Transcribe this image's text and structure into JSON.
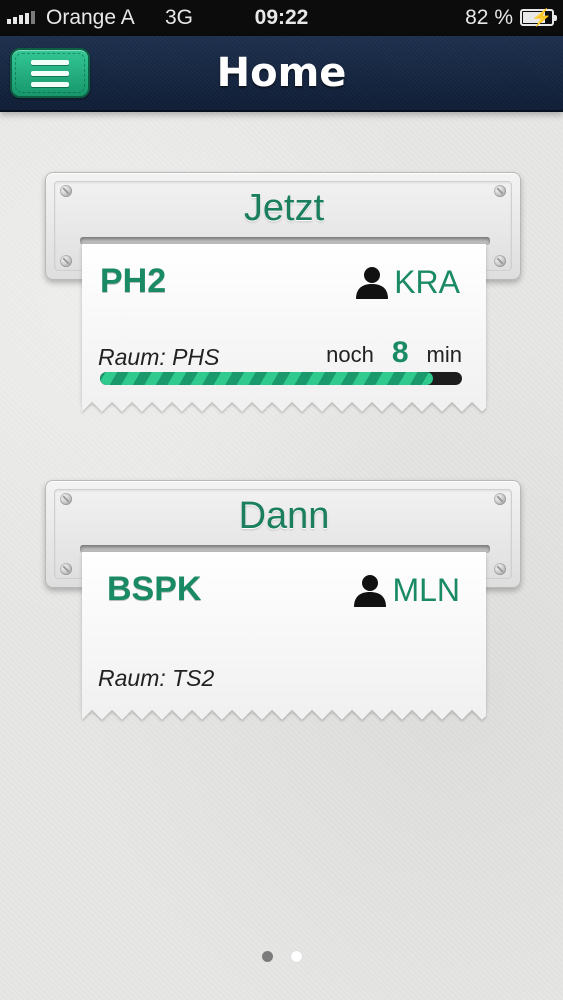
{
  "status_bar": {
    "carrier": "Orange A",
    "network": "3G",
    "time": "09:22",
    "battery": "82 %",
    "battery_level": 0.82
  },
  "nav": {
    "title": "Home",
    "menu_icon": "hamburger-menu-icon"
  },
  "cards": [
    {
      "title": "Jetzt",
      "subject": "PH2",
      "teacher": "KRA",
      "room": "Raum: PHS",
      "remaining_prefix": "noch",
      "remaining_value": "8",
      "remaining_unit": "min",
      "progress": 0.92
    },
    {
      "title": "Dann",
      "subject": "BSPK",
      "teacher": "MLN",
      "room": "Raum: TS2"
    }
  ],
  "pager": {
    "pages": 2,
    "current": 1
  },
  "colors": {
    "accent": "#1a8a64",
    "nav_background": "#13233f",
    "menu_button": "#25b183"
  }
}
